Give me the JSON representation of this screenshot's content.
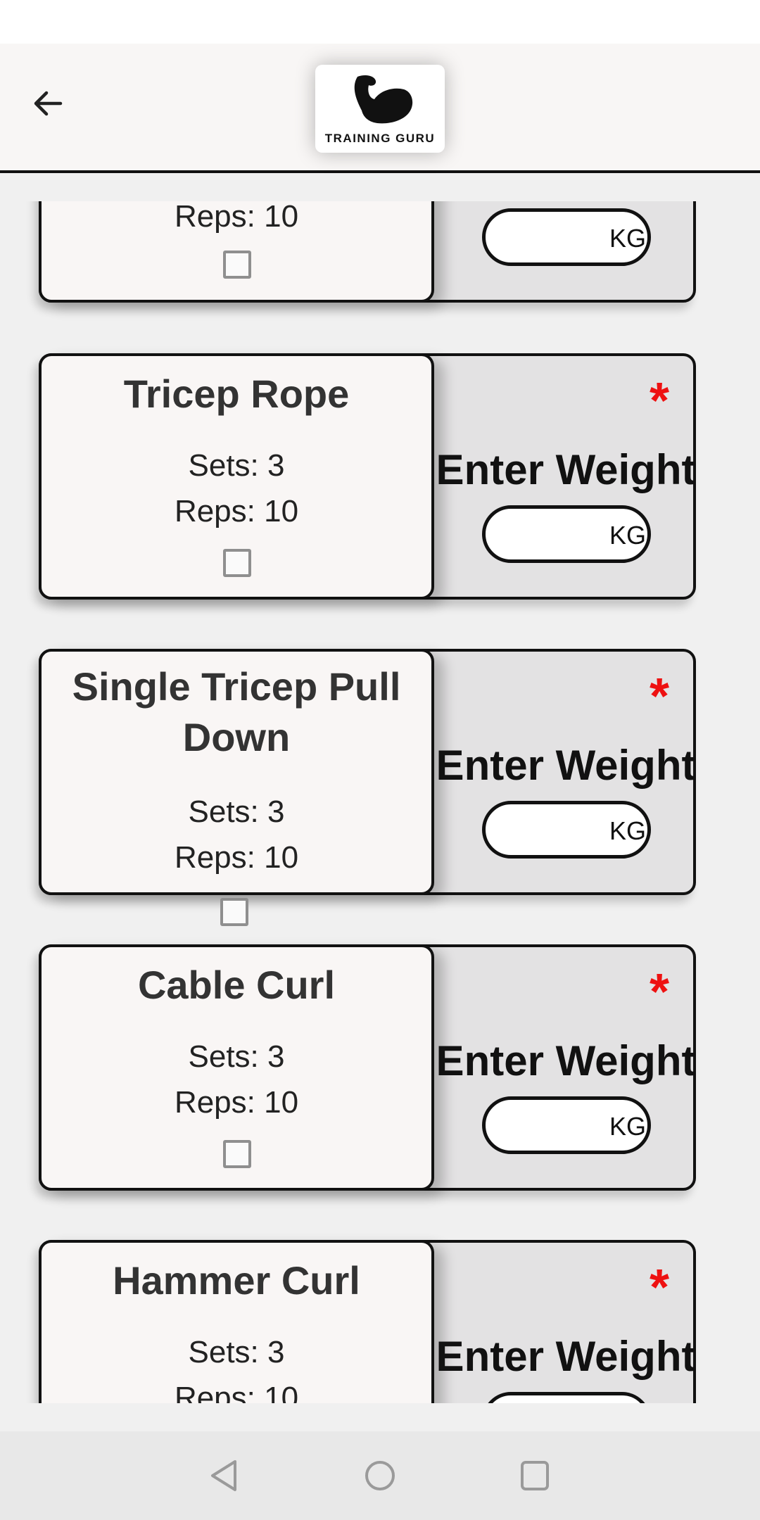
{
  "header": {
    "back_icon": "arrow-left-icon",
    "logo_icon": "flexed-bicep-icon",
    "logo_text": "TRAINING GURU"
  },
  "colors": {
    "header_bg": "#f8f6f5",
    "page_bg": "#f0f0f0",
    "card_left_bg": "#f9f6f5",
    "card_right_bg": "#e3e2e3",
    "required_star": "#ee1111"
  },
  "exercises": [
    {
      "name": "",
      "sets": "",
      "reps": "Reps: 10",
      "weight_label": "",
      "unit": "KG",
      "required_mark": ""
    },
    {
      "name": "Tricep Rope",
      "sets": "Sets: 3",
      "reps": "Reps: 10",
      "weight_label": "Enter Weight",
      "unit": "KG",
      "required_mark": "*"
    },
    {
      "name": "Single Tricep Pull Down",
      "sets": "Sets: 3",
      "reps": "Reps: 10",
      "weight_label": "Enter Weight",
      "unit": "KG",
      "required_mark": "*"
    },
    {
      "name": "Cable Curl",
      "sets": "Sets: 3",
      "reps": "Reps: 10",
      "weight_label": "Enter Weight",
      "unit": "KG",
      "required_mark": "*"
    },
    {
      "name": "Hammer Curl",
      "sets": "Sets: 3",
      "reps": "Reps: 10",
      "weight_label": "Enter Weight",
      "unit": "KG",
      "required_mark": "*"
    }
  ],
  "nav": {
    "back_icon": "triangle-back-icon",
    "home_icon": "circle-home-icon",
    "recents_icon": "square-recents-icon"
  }
}
